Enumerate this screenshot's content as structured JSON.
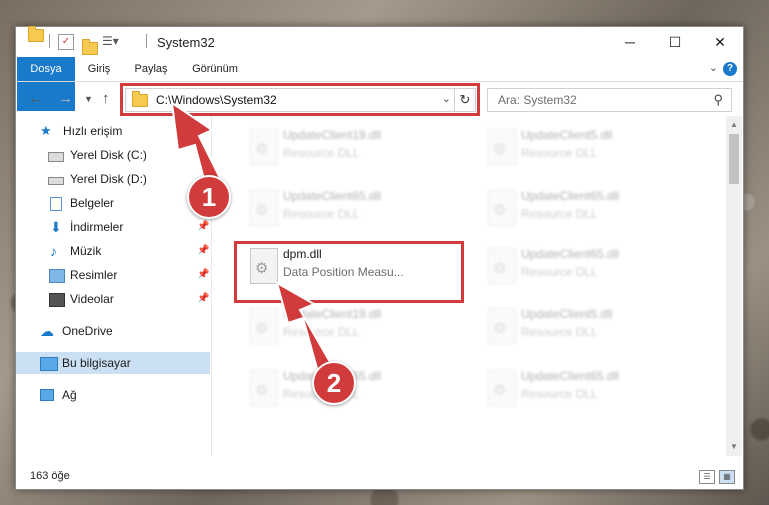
{
  "window": {
    "title": "System32",
    "controls": {
      "minimize": "─",
      "maximize": "☐",
      "close": "✕"
    }
  },
  "ribbon": {
    "tabs": [
      {
        "label": "Dosya"
      },
      {
        "label": "Giriş"
      },
      {
        "label": "Paylaş"
      },
      {
        "label": "Görünüm"
      }
    ],
    "help": "?"
  },
  "navigation": {
    "address_path": "C:\\Windows\\System32",
    "search_placeholder": "Ara: System32"
  },
  "sidebar": {
    "items": [
      {
        "label": "Hızlı erişim"
      },
      {
        "label": "Yerel Disk (C:)"
      },
      {
        "label": "Yerel Disk (D:)"
      },
      {
        "label": "Belgeler"
      },
      {
        "label": "İndirmeler"
      },
      {
        "label": "Müzik"
      },
      {
        "label": "Resimler"
      },
      {
        "label": "Videolar"
      },
      {
        "label": "OneDrive"
      },
      {
        "label": "Bu bilgisayar"
      },
      {
        "label": "Ağ"
      }
    ]
  },
  "files": [
    {
      "name": "UpdateClient19.dll",
      "desc": "Resource DLL"
    },
    {
      "name": "UpdateClient5.dll",
      "desc": "Resource DLL"
    },
    {
      "name": "UpdateClient65.dll",
      "desc": "Resource DLL"
    },
    {
      "name": "UpdateClient65.dll",
      "desc": "Resource DLL"
    },
    {
      "name": "dpm.dll",
      "desc": "Data Position Measu..."
    },
    {
      "name": "UpdateClient65.dll",
      "desc": "Resource DLL"
    },
    {
      "name": "UpdateClient19.dll",
      "desc": "Resource DLL"
    },
    {
      "name": "UpdateClient5.dll",
      "desc": "Resource DLL"
    },
    {
      "name": "UpdateClient65.dll",
      "desc": "Resource DLL"
    },
    {
      "name": "UpdateClient65.dll",
      "desc": "Resource DLL"
    }
  ],
  "status": {
    "item_count": "163 öğe"
  },
  "annotations": {
    "marker1": "1",
    "marker2": "2"
  },
  "colors": {
    "accent": "#1979ca",
    "highlight_red": "#d23b3b",
    "selection": "#cce0f4"
  }
}
